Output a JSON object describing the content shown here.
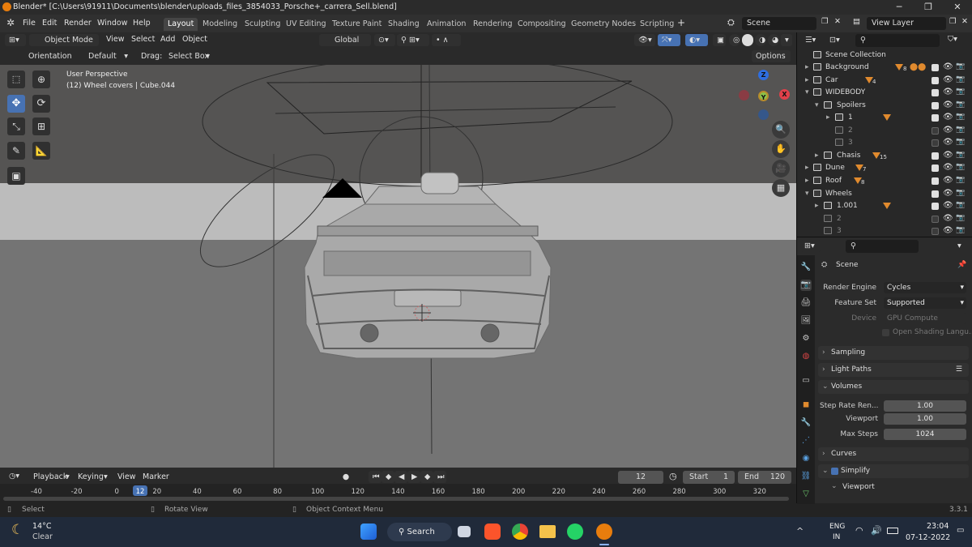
{
  "titlebar": {
    "title": "Blender* [C:\\Users\\91911\\Documents\\blender\\uploads_files_3854033_Porsche+_carrera_Sell.blend]"
  },
  "menu": {
    "file": "File",
    "edit": "Edit",
    "render": "Render",
    "window": "Window",
    "help": "Help"
  },
  "workspaces": [
    "Layout",
    "Modeling",
    "Sculpting",
    "UV Editing",
    "Texture Paint",
    "Shading",
    "Animation",
    "Rendering",
    "Compositing",
    "Geometry Nodes",
    "Scripting"
  ],
  "scene_field": "Scene",
  "view_layer_field": "View Layer",
  "viewport_header": {
    "mode": "Object Mode",
    "view": "View",
    "select": "Select",
    "add": "Add",
    "object": "Object",
    "transform": "Global"
  },
  "tool_settings": {
    "orientation_label": "Orientation:",
    "orientation_value": "Default",
    "drag_label": "Drag:",
    "drag_value": "Select Box",
    "options": "Options"
  },
  "viewport_info": {
    "perspective": "User Perspective",
    "object": "(12) Wheel covers | Cube.044"
  },
  "gizmo": {
    "z": "Z",
    "y": "Y",
    "x": "X"
  },
  "outliner": {
    "rows": [
      {
        "label": "Scene Collection",
        "checked": null
      },
      {
        "label": "Background",
        "checked": true
      },
      {
        "label": "Car",
        "checked": true
      },
      {
        "label": "WIDEBODY",
        "checked": true
      },
      {
        "label": "Spoilers",
        "checked": true
      },
      {
        "label": "1",
        "checked": true
      },
      {
        "label": "2",
        "checked": false
      },
      {
        "label": "3",
        "checked": false
      },
      {
        "label": "Chasis",
        "checked": true
      },
      {
        "label": "Dune",
        "checked": true
      },
      {
        "label": "Roof",
        "checked": true
      },
      {
        "label": "Wheels",
        "checked": true
      },
      {
        "label": "1.001",
        "checked": true
      },
      {
        "label": "2",
        "checked": false
      },
      {
        "label": "3",
        "checked": false
      }
    ],
    "badges": {
      "chasis": "15",
      "dune": "7",
      "roof": "8",
      "background": "8",
      "car": "4"
    }
  },
  "properties": {
    "context": "Scene",
    "render_engine_label": "Render Engine",
    "render_engine": "Cycles",
    "feature_set_label": "Feature Set",
    "feature_set": "Supported",
    "device_label": "Device",
    "device": "GPU Compute",
    "osl_label": "Open Shading Langu...",
    "sections": {
      "sampling": "Sampling",
      "light_paths": "Light Paths",
      "volumes": "Volumes",
      "curves": "Curves",
      "simplify": "Simplify",
      "viewport": "Viewport"
    },
    "step_rate_render_label": "Step Rate Ren...",
    "step_rate_render": "1.00",
    "viewport_label": "Viewport",
    "viewport_value": "1.00",
    "max_steps_label": "Max Steps",
    "max_steps": "1024"
  },
  "timeline": {
    "playback": "Playback",
    "keying": "Keying",
    "view": "View",
    "marker": "Marker",
    "current_frame": "12",
    "start_label": "Start",
    "start": "1",
    "end_label": "End",
    "end": "120",
    "ticks": [
      "-40",
      "-20",
      "0",
      "12",
      "20",
      "40",
      "60",
      "80",
      "100",
      "120",
      "140",
      "160",
      "180",
      "200",
      "220",
      "240",
      "260",
      "280",
      "300",
      "320"
    ]
  },
  "statusbar": {
    "select": "Select",
    "rotate": "Rotate View",
    "context": "Object Context Menu",
    "version": "3.3.1"
  },
  "taskbar": {
    "weather_temp": "14°C",
    "weather_desc": "Clear",
    "search": "Search",
    "lang1": "ENG",
    "lang2": "IN",
    "time": "23:04",
    "date": "07-12-2022"
  }
}
